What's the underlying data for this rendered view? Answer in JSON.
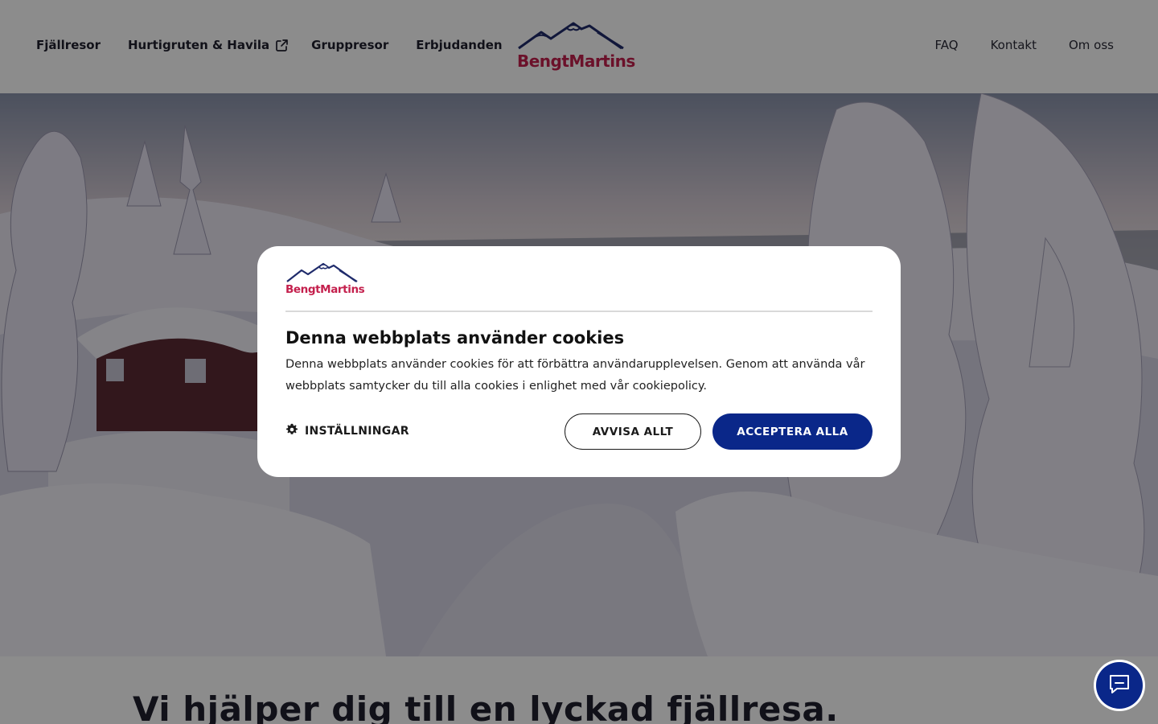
{
  "header": {
    "nav_left": [
      "Fjällresor",
      "Hurtigruten & Havila",
      "Gruppresor",
      "Erbjudanden"
    ],
    "nav_right": [
      "FAQ",
      "Kontakt",
      "Om oss"
    ],
    "logo_text": "BengtMartins"
  },
  "hero": {
    "headline": "Vi hjälper dig till en lyckad fjällresa."
  },
  "cookie_banner": {
    "logo_text": "BengtMartins",
    "title": "Denna webbplats använder cookies",
    "body": "Denna webbplats använder cookies för att förbättra användarupplevelsen. Genom att använda vår webbplats samtycker du till alla cookies i enlighet med vår cookiepolicy.",
    "settings_label": "INSTÄLLNINGAR",
    "reject_label": "AVVISA ALLT",
    "accept_label": "ACCEPTERA ALLA"
  },
  "icons": {
    "external": "external-link-icon",
    "settings": "gear-icon",
    "chat": "chat-bubble-icon"
  },
  "colors": {
    "brand_red": "#c4204d",
    "brand_navy": "#0a2789",
    "logo_mountain": "#1f2b6b"
  }
}
